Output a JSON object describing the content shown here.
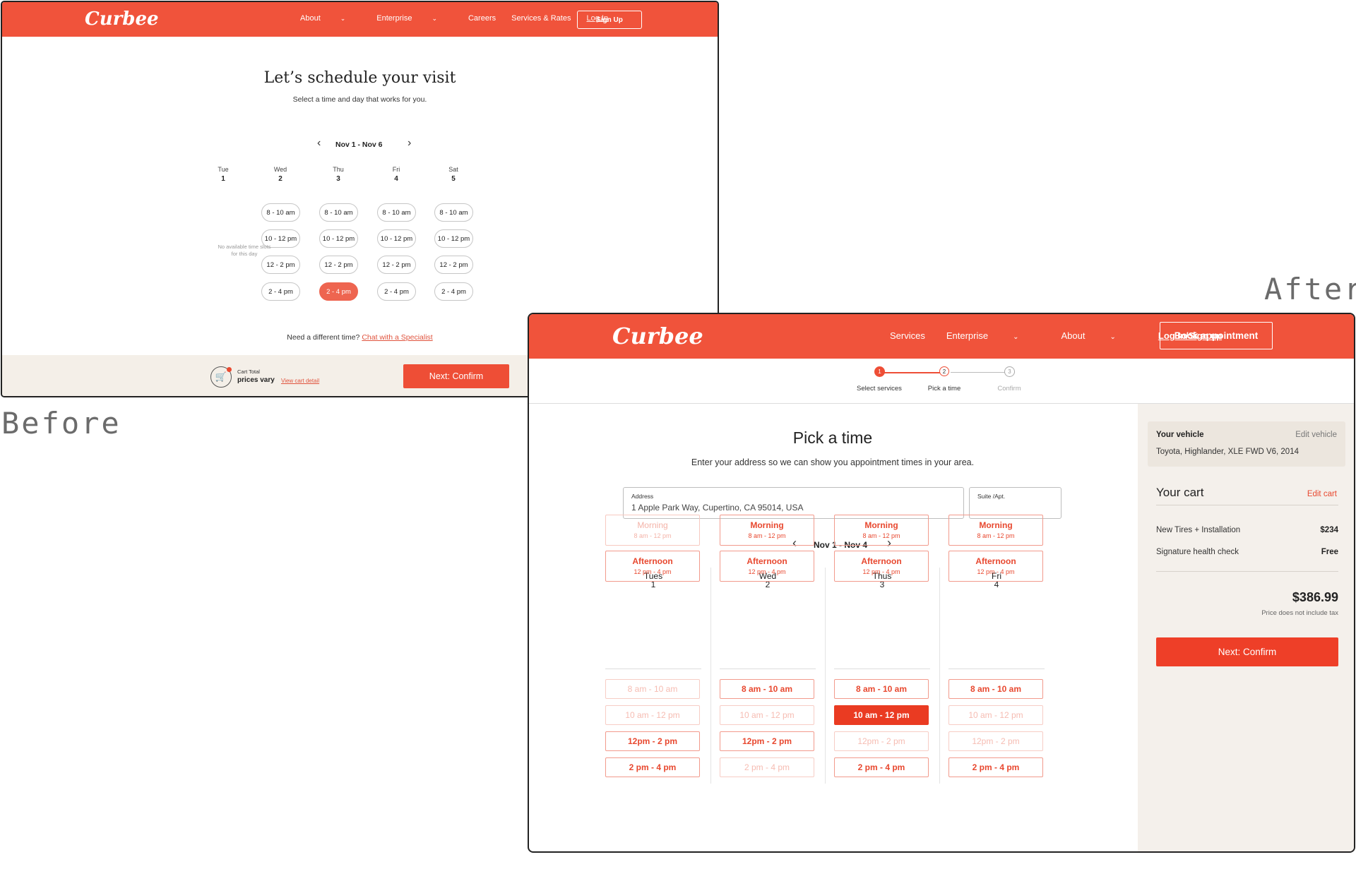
{
  "labels": {
    "before": "Before",
    "after": "After"
  },
  "colors": {
    "brand": "#f0533b",
    "accent": "#ea3b22",
    "sidebar_bg": "#f4f0eb",
    "footer_bg": "#f4efe8"
  },
  "before": {
    "logo": "Curbee",
    "nav": {
      "about": "About",
      "enterprise": "Enterprise",
      "careers": "Careers",
      "services": "Services & Rates",
      "login": "Log In",
      "signup": "Sign Up"
    },
    "title": "Let’s schedule your visit",
    "subtitle": "Select a time and day that works for you.",
    "week": "Nov 1 - Nov 6",
    "days": [
      {
        "name": "Tue",
        "date": "1",
        "no_slots": "No available time slots for this day"
      },
      {
        "name": "Wed",
        "date": "2",
        "slots": [
          "8 - 10 am",
          "10 - 12 pm",
          "12 - 2 pm",
          "2 - 4 pm"
        ]
      },
      {
        "name": "Thu",
        "date": "3",
        "slots": [
          "8 - 10 am",
          "10 - 12 pm",
          "12 - 2 pm",
          "2 - 4 pm"
        ]
      },
      {
        "name": "Fri",
        "date": "4",
        "slots": [
          "8 - 10 am",
          "10 - 12 pm",
          "12 - 2 pm",
          "2 - 4 pm"
        ]
      },
      {
        "name": "Sat",
        "date": "5",
        "slots": [
          "8 - 10 am",
          "10 - 12 pm",
          "12 - 2 pm",
          "2 - 4 pm"
        ]
      }
    ],
    "selected_slot": "Thu 2 - 4 pm",
    "need_text": "Need a different time?",
    "need_link": "Chat with a Specialist",
    "cart_label": "Cart Total",
    "cart_value": "prices vary",
    "cart_link": "View cart detail",
    "next": "Next: Confirm"
  },
  "after": {
    "logo": "Curbee",
    "nav": {
      "services": "Services",
      "enterprise": "Enterprise",
      "about": "About",
      "login": "Log In/Sign up",
      "book": "Book appointment"
    },
    "steps": [
      {
        "num": "1",
        "label": "Select services",
        "state": "complete"
      },
      {
        "num": "2",
        "label": "Pick a time",
        "state": "current"
      },
      {
        "num": "3",
        "label": "Confirm",
        "state": "upcoming"
      }
    ],
    "title": "Pick a time",
    "subtitle": "Enter your address so we can show you appointment times in your area.",
    "address": {
      "label": "Address",
      "value": "1 Apple Park Way, Cupertino, CA 95014, USA"
    },
    "suite": {
      "label": "Suite /Apt.",
      "value": ""
    },
    "week": "Nov 1 - Nov 4",
    "days": [
      {
        "name": "Tues",
        "date": "1",
        "periods": [
          {
            "name": "Morning",
            "time": "8 am - 12 pm",
            "available": false
          },
          {
            "name": "Afternoon",
            "time": "12 pm - 4 pm",
            "available": true
          }
        ],
        "slots": [
          {
            "label": "8 am - 10 am",
            "state": "disabled"
          },
          {
            "label": "10 am - 12 pm",
            "state": "disabled"
          },
          {
            "label": "12pm - 2 pm",
            "state": "available"
          },
          {
            "label": "2 pm - 4 pm",
            "state": "available"
          }
        ]
      },
      {
        "name": "Wed",
        "date": "2",
        "periods": [
          {
            "name": "Morning",
            "time": "8 am - 12 pm",
            "available": true
          },
          {
            "name": "Afternoon",
            "time": "12 pm - 4 pm",
            "available": true
          }
        ],
        "slots": [
          {
            "label": "8 am - 10 am",
            "state": "available"
          },
          {
            "label": "10 am - 12 pm",
            "state": "disabled"
          },
          {
            "label": "12pm - 2 pm",
            "state": "available"
          },
          {
            "label": "2 pm - 4 pm",
            "state": "disabled"
          }
        ]
      },
      {
        "name": "Thus",
        "date": "3",
        "periods": [
          {
            "name": "Morning",
            "time": "8 am - 12 pm",
            "available": true
          },
          {
            "name": "Afternoon",
            "time": "12 pm - 4 pm",
            "available": true
          }
        ],
        "slots": [
          {
            "label": "8 am - 10 am",
            "state": "available"
          },
          {
            "label": "10 am - 12 pm",
            "state": "selected"
          },
          {
            "label": "12pm - 2 pm",
            "state": "disabled"
          },
          {
            "label": "2 pm - 4 pm",
            "state": "available"
          }
        ]
      },
      {
        "name": "Fri",
        "date": "4",
        "periods": [
          {
            "name": "Morning",
            "time": "8 am - 12 pm",
            "available": true
          },
          {
            "name": "Afternoon",
            "time": "12 pm - 4 pm",
            "available": true
          }
        ],
        "slots": [
          {
            "label": "8 am - 10 am",
            "state": "available"
          },
          {
            "label": "10 am - 12 pm",
            "state": "disabled"
          },
          {
            "label": "12pm - 2 pm",
            "state": "disabled"
          },
          {
            "label": "2 pm - 4 pm",
            "state": "available"
          }
        ]
      }
    ],
    "sidebar": {
      "vehicle_label": "Your vehicle",
      "edit_vehicle": "Edit vehicle",
      "vehicle": "Toyota, Highlander, XLE FWD V6, 2014",
      "cart_title": "Your cart",
      "edit_cart": "Edit cart",
      "items": [
        {
          "name": "New Tires + Installation",
          "price": "$234"
        },
        {
          "name": "Signature health check",
          "price": "Free"
        }
      ],
      "total": "$386.99",
      "tax_note": "Price does not include tax",
      "next": "Next: Confirm"
    }
  }
}
